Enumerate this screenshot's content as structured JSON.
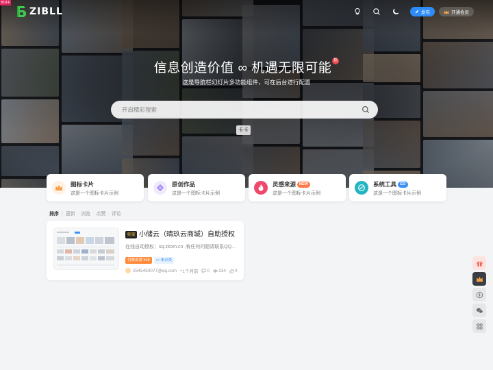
{
  "corner_tag": "BOFF",
  "logo": {
    "text": "ZIBLL"
  },
  "nav": {
    "publish_label": "发布",
    "vip_label": "开通会员"
  },
  "hero": {
    "title": "信息创造价值 ∞ 机遇无限可能",
    "hot_badge": "热",
    "subtitle": "这是导航栏幻灯片多功能组件，可在后台进行配置",
    "search_placeholder": "开启精彩搜索",
    "tooltip": "卡卡"
  },
  "features": [
    {
      "title": "图标卡片",
      "desc": "这是一个图标卡片示例",
      "icon": "crown-icon",
      "color": "#f5a04a",
      "bg": "#fff1e3"
    },
    {
      "title": "原创作品",
      "desc": "这是一个图标卡片示例",
      "icon": "diamond-icon",
      "color": "#9b7cf0",
      "bg": "#efeafd"
    },
    {
      "title": "灵感来源",
      "badge": "NEW",
      "desc": "这是一个图标卡片示例",
      "icon": "flame-icon",
      "color": "#ffffff",
      "bg": "#f0486a"
    },
    {
      "title": "系统工具",
      "badge": "GO",
      "desc": "这是一个图标卡片示例",
      "icon": "tools-icon",
      "color": "#ffffff",
      "bg": "#23b6c2"
    }
  ],
  "sortbar": {
    "label": "排序",
    "options": [
      "更新",
      "浏览",
      "点赞",
      "评论"
    ]
  },
  "post": {
    "sale_tag": "卖家",
    "title": "小储云（晴玖云商城）自助授权",
    "excerpt": "在线自动授权：sq.zkom.cn ,有任何问题请联系QQ...",
    "paid_tag": "付费资源 ¥38",
    "category": "未分类",
    "author": "2545450077@qq.com",
    "time": "1个月前",
    "comments": "0",
    "views": "134",
    "likes": "0"
  },
  "floating": [
    "gift-icon",
    "crown-icon",
    "plus-icon",
    "wechat-icon",
    "grid-icon"
  ]
}
